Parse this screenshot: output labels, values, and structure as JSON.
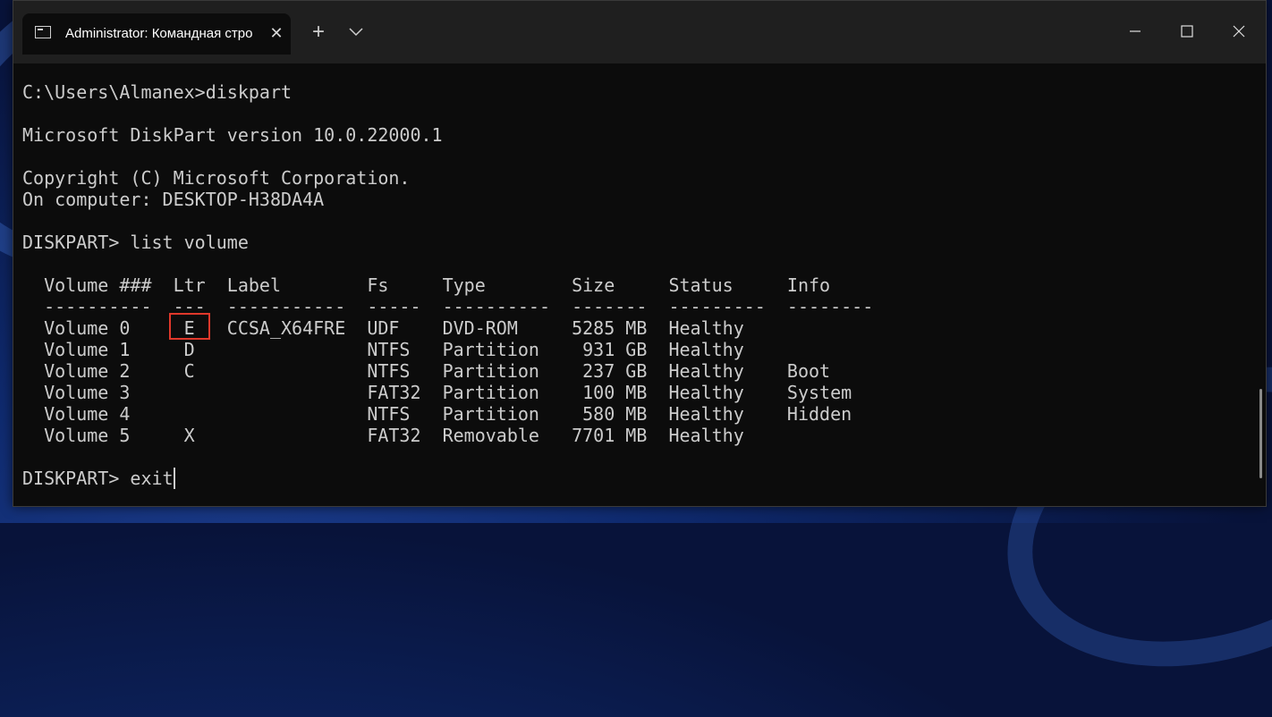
{
  "window": {
    "tab_title": "Administrator: Командная стро",
    "controls": [
      "minimize-icon",
      "maximize-icon",
      "close-icon"
    ],
    "new_tab_glyph": "+"
  },
  "console": {
    "lines": {
      "l0": "C:\\Users\\Almanex>diskpart",
      "l1": "Microsoft DiskPart version 10.0.22000.1",
      "l2": "Copyright (C) Microsoft Corporation.",
      "l3": "On computer: DESKTOP-H38DA4A",
      "l4": "DISKPART> list volume",
      "l5": "  Volume ###  Ltr  Label        Fs     Type        Size     Status     Info",
      "l6": "  ----------  ---  -----------  -----  ----------  -------  ---------  --------",
      "l7": "  Volume 0     E   CCSA_X64FRE  UDF    DVD-ROM     5285 MB  Healthy",
      "l8": "  Volume 1     D                NTFS   Partition    931 GB  Healthy",
      "l9": "  Volume 2     C                NTFS   Partition    237 GB  Healthy    Boot",
      "l10": "  Volume 3                      FAT32  Partition    100 MB  Healthy    System",
      "l11": "  Volume 4                      NTFS   Partition    580 MB  Healthy    Hidden",
      "l12": "  Volume 5     X                FAT32  Removable   7701 MB  Healthy",
      "l13": "DISKPART> exit"
    },
    "text_color": "#cccccc",
    "background": "#0c0c0c",
    "highlight_color": "#e0382b"
  }
}
